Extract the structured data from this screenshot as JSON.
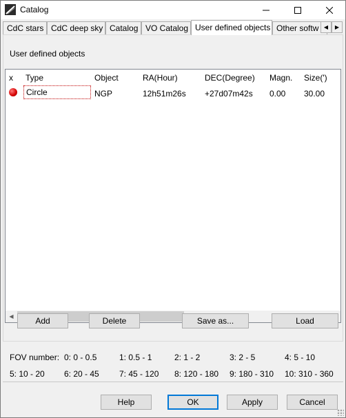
{
  "window": {
    "title": "Catalog"
  },
  "tabs": [
    {
      "label": "CdC stars"
    },
    {
      "label": "CdC deep sky"
    },
    {
      "label": "Catalog"
    },
    {
      "label": "VO Catalog"
    },
    {
      "label": "User defined objects"
    },
    {
      "label": "Other softw"
    }
  ],
  "panel": {
    "heading": "User defined objects"
  },
  "table": {
    "columns": [
      "x",
      "Type",
      "Object",
      "RA(Hour)",
      "DEC(Degree)",
      "Magn.",
      "Size(')"
    ],
    "rows": [
      {
        "marker": "red-dot",
        "type": "Circle",
        "object": "NGP",
        "ra": "12h51m26s",
        "dec": "+27d07m42s",
        "magn": "0.00",
        "size": "30.00"
      }
    ]
  },
  "buttons": {
    "add": "Add",
    "delete": "Delete",
    "save_as": "Save as...",
    "load": "Load",
    "help": "Help",
    "ok": "OK",
    "apply": "Apply",
    "cancel": "Cancel"
  },
  "fov": {
    "label": "FOV number:",
    "ranges": [
      "0: 0 - 0.5",
      "1: 0.5 - 1",
      "2: 1 - 2",
      "3: 2 - 5",
      "4: 5 - 10",
      "5: 10 - 20",
      "6: 20 - 45",
      "7: 45 - 120",
      "8: 120 - 180",
      "9: 180 - 310",
      "10: 310 - 360"
    ]
  },
  "colors": {
    "accent": "#0078d7",
    "marker": "#d40000",
    "selection_border": "#c00000"
  },
  "icons": [
    "app-icon",
    "minimize-icon",
    "maximize-icon",
    "close-icon",
    "tab-scroll-left-icon",
    "tab-scroll-right-icon",
    "scroll-left-icon",
    "scroll-right-icon",
    "size-grip-icon"
  ]
}
